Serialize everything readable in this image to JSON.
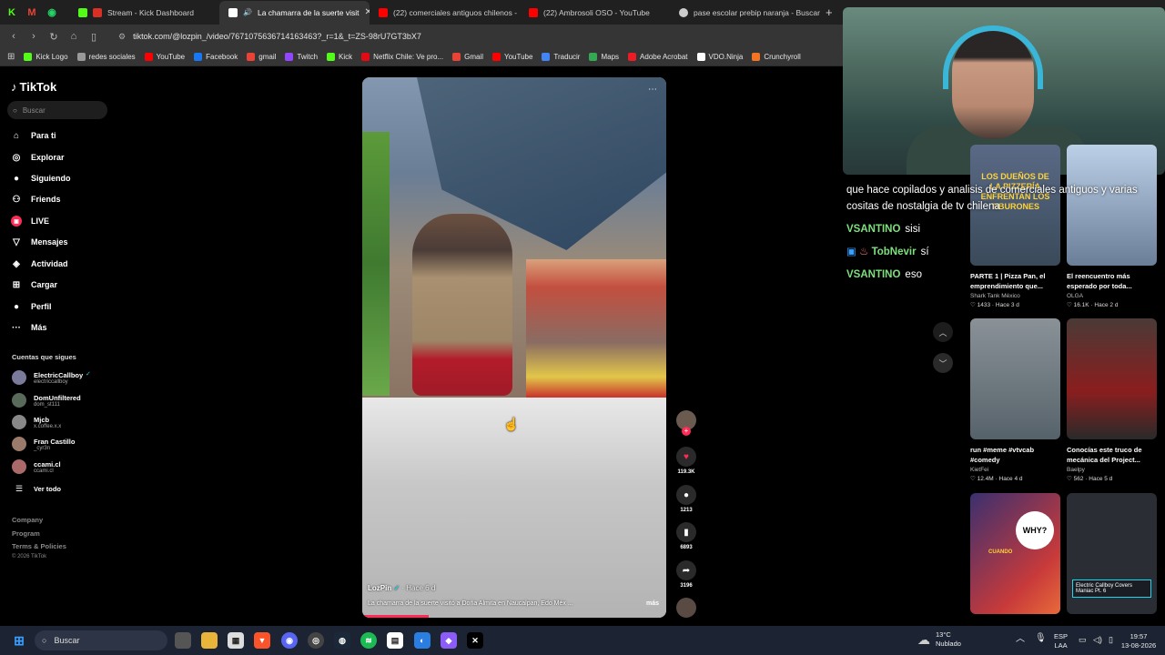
{
  "browser": {
    "tabs": [
      {
        "title": "Stream - Kick Dashboard",
        "color": "#d93025"
      },
      {
        "title": "La chamarra de la suerte visit",
        "color": "#ffffff",
        "active": true
      },
      {
        "title": "(22) comerciales antiguos chilenos -",
        "color": "#ff0000"
      },
      {
        "title": "(22) Ambrosoli OSO - YouTube",
        "color": "#ff0000"
      },
      {
        "title": "pase escolar prebip naranja - Buscar",
        "color": "#cccccc"
      }
    ],
    "close_glyph": "✕",
    "new_tab_glyph": "+",
    "url": "tiktok.com/@lozpin_/video/7671075636714163463?_r=1&_t=ZS-98rU7GT3bX7",
    "bookmarks": [
      {
        "label": "Kick Logo",
        "color": "#53fc18"
      },
      {
        "label": "redes sociales",
        "color": "#999999"
      },
      {
        "label": "YouTube",
        "color": "#ff0000"
      },
      {
        "label": "Facebook",
        "color": "#1877f2"
      },
      {
        "label": "gmail",
        "color": "#ea4335"
      },
      {
        "label": "Twitch",
        "color": "#9146ff"
      },
      {
        "label": "Kick",
        "color": "#53fc18"
      },
      {
        "label": "Netflix Chile: Ve pro...",
        "color": "#e50914"
      },
      {
        "label": "Gmail",
        "color": "#ea4335"
      },
      {
        "label": "YouTube",
        "color": "#ff0000"
      },
      {
        "label": "Traducir",
        "color": "#4285f4"
      },
      {
        "label": "Maps",
        "color": "#34a853"
      },
      {
        "label": "Adobe Acrobat",
        "color": "#ec1c24"
      },
      {
        "label": "VDO.Ninja",
        "color": "#ffffff"
      },
      {
        "label": "Crunchyroll",
        "color": "#f47521"
      }
    ]
  },
  "tiktok": {
    "logo": "TikTok",
    "search_placeholder": "Buscar",
    "menu": [
      {
        "label": "Para ti",
        "icon": "home-icon",
        "glyph": "⌂"
      },
      {
        "label": "Explorar",
        "icon": "compass-icon",
        "glyph": "◎"
      },
      {
        "label": "Siguiendo",
        "icon": "following-icon",
        "glyph": "●"
      },
      {
        "label": "Friends",
        "icon": "friends-icon",
        "glyph": "⚇"
      },
      {
        "label": "LIVE",
        "icon": "live-icon",
        "glyph": "▣"
      },
      {
        "label": "Mensajes",
        "icon": "messages-icon",
        "glyph": "▽"
      },
      {
        "label": "Actividad",
        "icon": "activity-icon",
        "glyph": "◈"
      },
      {
        "label": "Cargar",
        "icon": "upload-icon",
        "glyph": "⊞"
      },
      {
        "label": "Perfil",
        "icon": "profile-icon",
        "glyph": "●"
      },
      {
        "label": "Más",
        "icon": "more-icon",
        "glyph": "···"
      }
    ],
    "following_title": "Cuentas que sigues",
    "accounts": [
      {
        "name": "ElectricCallboy",
        "handle": "electriccallboy"
      },
      {
        "name": "DomUnfiltered",
        "handle": "dom_st111"
      },
      {
        "name": "Mjcb",
        "handle": "x.coffee.x.x"
      },
      {
        "name": "Fran Castillo",
        "handle": "_cyr3n"
      },
      {
        "name": "ccami.cl",
        "handle": "ccami.cl"
      }
    ],
    "see_all": "Ver todo",
    "footer": [
      "Company",
      "Program",
      "Terms & Policies",
      "© 2026 TikTok"
    ]
  },
  "video": {
    "author": "LozPin",
    "time": "· Hace 6 d",
    "description": "La chamarra de la suerte visitó a Doña Almita en Naucalpan, Edo Méx ...",
    "more": "más",
    "progress": 0.22,
    "likes": "119.3K",
    "comments": "1213",
    "saves": "6893",
    "shares": "3196",
    "menu_glyph": "⋯"
  },
  "chat": [
    {
      "user": "",
      "text": "que hace copilados y analisis de comerciales antiguos y varias cositas de nostalgia de tv chilena"
    },
    {
      "user": "VSANTINO",
      "text": "sisi"
    },
    {
      "user": "TobNevir",
      "text": "sí",
      "badges": true
    },
    {
      "user": "VSANTINO",
      "text": "eso"
    }
  ],
  "recommended": [
    {
      "title": "PARTE 1 | Pizza Pan, el emprendimiento que...",
      "author": "Shark Tank México",
      "likes": "1433",
      "time": "Hace 3 d",
      "thumb_text": "LOS DUEÑOS DE LA PIZZERÍA ENFRENTAN LOS TIBURONES",
      "bg": "#6a7a92"
    },
    {
      "title": "El reencuentro más esperado por toda...",
      "author": "OLGA",
      "likes": "16.1K",
      "time": "Hace 2 d",
      "thumb_text": "",
      "bg": "#8aa4c4"
    },
    {
      "title": "run #meme #vtvcab #comedy",
      "author": "KietFei",
      "likes": "12.4M",
      "time": "Hace 4 d",
      "thumb_text": "",
      "bg": "#7a8288"
    },
    {
      "title": "Conocías este truco de mecánica del Project...",
      "author": "Baelpy",
      "likes": "562",
      "time": "Hace 5 d",
      "thumb_text": "",
      "bg": "#3a3230"
    },
    {
      "title": "",
      "author": "",
      "likes": "",
      "time": "",
      "thumb_text": "WHY?",
      "thumb_text2": "CUANDO",
      "bg": "#3c3a78"
    },
    {
      "title": "",
      "author": "",
      "likes": "",
      "time": "",
      "thumb_text": "Electric Callboy Covers Maniac Pt. 6",
      "bg": "#2a2e34"
    }
  ],
  "taskbar": {
    "search_placeholder": "Buscar",
    "weather_temp": "13°C",
    "weather_desc": "Nublado",
    "lang": "ESP",
    "lang2": "LAA",
    "time": "19:57",
    "date": "13-08-2026"
  }
}
